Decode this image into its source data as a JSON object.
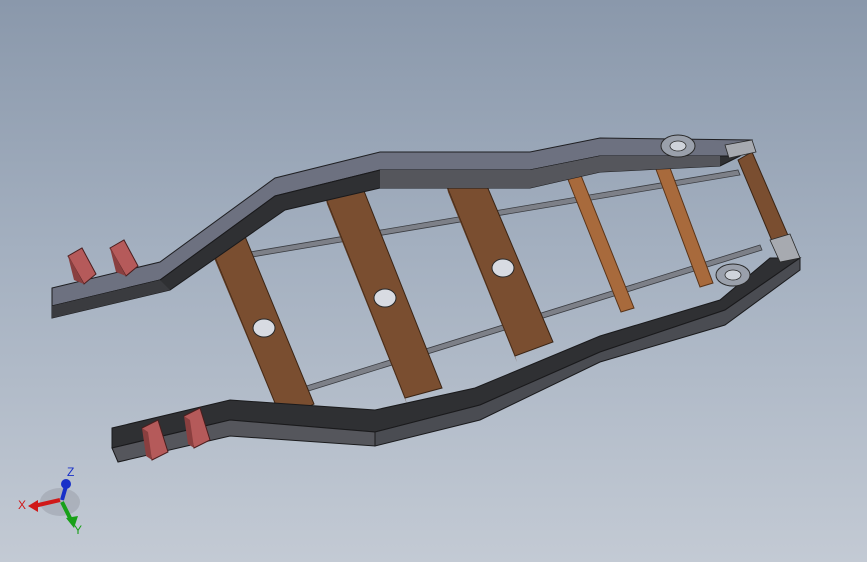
{
  "viewport": {
    "background_top": "#8a98ab",
    "background_bottom": "#c3cad4"
  },
  "model": {
    "frame_dark": "#2f3033",
    "frame_side": "#55565c",
    "frame_top": "#6d7180",
    "crossmember_color": "#7a4e30",
    "crossmember_shade": "#5e3a22",
    "rod_color": "#a86a3c",
    "bracket_color": "#b55a5a",
    "bracket_shade": "#8a3f3f",
    "hole_color": "#d8dbe2"
  },
  "triad": {
    "x_label": "X",
    "y_label": "Y",
    "z_label": "Z",
    "x_color": "#d01818",
    "y_color": "#18a018",
    "z_color": "#1830c8"
  }
}
